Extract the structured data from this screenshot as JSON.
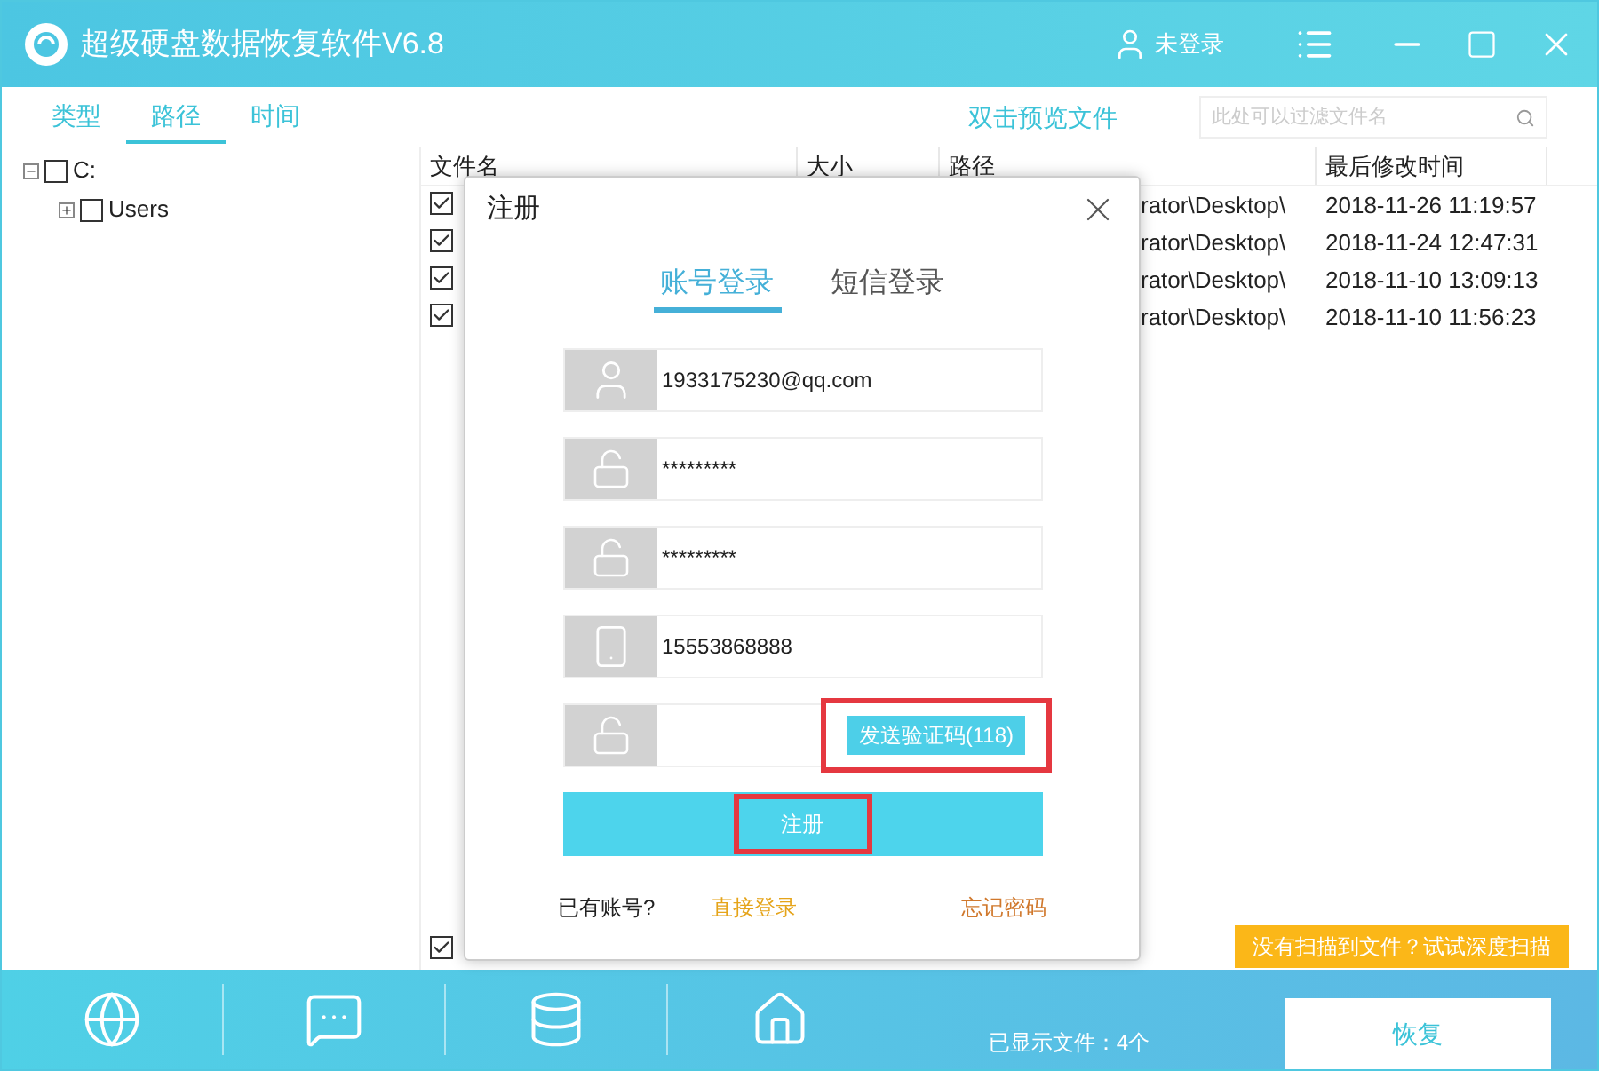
{
  "window": {
    "title": "超级硬盘数据恢复软件V6.8",
    "user": "未登录"
  },
  "tabs": [
    {
      "label": "类型",
      "selected": false
    },
    {
      "label": "路径",
      "selected": true
    },
    {
      "label": "时间",
      "selected": false
    }
  ],
  "preview_hint": "双击预览文件",
  "search": {
    "placeholder": "此处可以过滤文件名"
  },
  "tree": [
    {
      "label": "C:",
      "expanded": true,
      "checked": false,
      "children": [
        {
          "label": "Users",
          "expanded": false,
          "checked": false
        }
      ]
    }
  ],
  "table": {
    "columns": [
      "文件名",
      "大小",
      "路径",
      "最后修改时间"
    ],
    "rows": [
      {
        "checked": true,
        "path": "rator\\Desktop\\",
        "modified": "2018-11-26 11:19:57"
      },
      {
        "checked": true,
        "path": "rator\\Desktop\\",
        "modified": "2018-11-24 12:47:31"
      },
      {
        "checked": true,
        "path": "rator\\Desktop\\",
        "modified": "2018-11-10 13:09:13"
      },
      {
        "checked": true,
        "path": "rator\\Desktop\\",
        "modified": "2018-11-10 11:56:23"
      }
    ]
  },
  "select_all": {
    "checked": true
  },
  "deep_scan_button": "没有扫描到文件？试试深度扫描",
  "toolbar": [
    {
      "kind": "globe"
    },
    {
      "kind": "chat"
    },
    {
      "kind": "database"
    },
    {
      "kind": "home"
    }
  ],
  "status": "已显示文件：4个",
  "recover_button": "恢复",
  "dialog": {
    "title": "注册",
    "tabs": [
      {
        "label": "账号登录",
        "selected": true
      },
      {
        "label": "短信登录",
        "selected": false
      }
    ],
    "fields": [
      {
        "kind": "user",
        "value": "1933175230@qq.com"
      },
      {
        "kind": "lock",
        "value": "*********"
      },
      {
        "kind": "lock",
        "value": "*********"
      },
      {
        "kind": "phone",
        "value": "15553868888"
      },
      {
        "kind": "lock",
        "action": "发送验证码(118)"
      }
    ],
    "submit": "注册",
    "footer": {
      "prompt": "已有账号?",
      "login_link": "直接登录",
      "forgot_link": "忘记密码"
    }
  }
}
